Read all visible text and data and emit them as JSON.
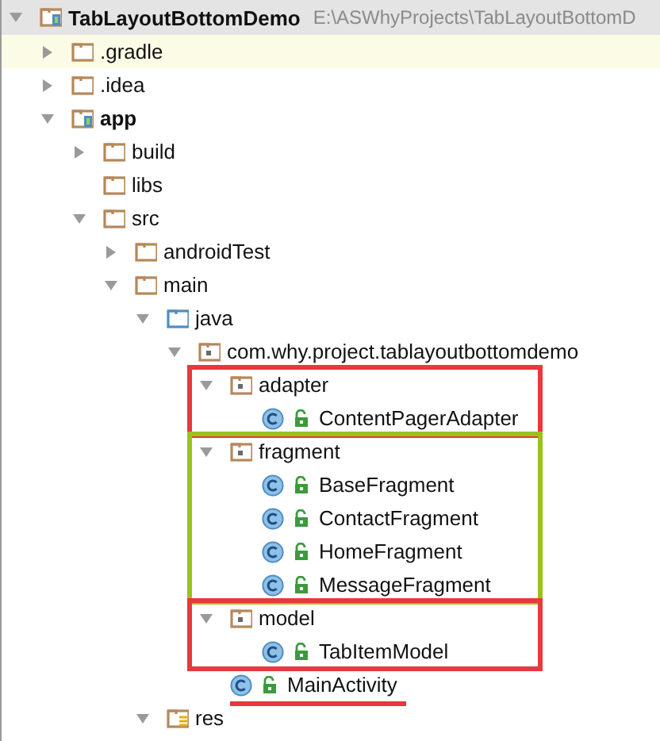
{
  "project": {
    "name": "TabLayoutBottomDemo",
    "path": "E:\\ASWhyProjects\\TabLayoutBottomD",
    "expanded": true,
    "selected": true,
    "kind": "module",
    "children": [
      {
        "label": ".gradle",
        "kind": "folder",
        "expanded": false,
        "hovered": true
      },
      {
        "label": ".idea",
        "kind": "folder",
        "expanded": false,
        "hovered": false
      },
      {
        "label": "app",
        "kind": "module",
        "expanded": true,
        "hovered": false,
        "children": [
          {
            "label": "build",
            "kind": "folder",
            "expanded": false,
            "hovered": false
          },
          {
            "label": "libs",
            "kind": "folder",
            "hovered": false
          },
          {
            "label": "src",
            "kind": "folder",
            "expanded": true,
            "hovered": false,
            "children": [
              {
                "label": "androidTest",
                "kind": "folder",
                "expanded": false,
                "hovered": false
              },
              {
                "label": "main",
                "kind": "folder",
                "expanded": true,
                "hovered": false,
                "children": [
                  {
                    "label": "java",
                    "kind": "source-folder",
                    "expanded": true,
                    "hovered": false,
                    "children": [
                      {
                        "label": "com.why.project.tablayoutbottomdemo",
                        "kind": "package",
                        "expanded": true,
                        "hovered": false,
                        "children": [
                          {
                            "label": "adapter",
                            "kind": "package",
                            "expanded": true,
                            "hovered": false,
                            "highlight": {
                              "kind": "box",
                              "color": "#e8383d"
                            },
                            "children": [
                              {
                                "label": "ContentPagerAdapter",
                                "kind": "class",
                                "hovered": false
                              }
                            ]
                          },
                          {
                            "label": "fragment",
                            "kind": "package",
                            "expanded": true,
                            "hovered": false,
                            "highlight": {
                              "kind": "box",
                              "color": "#99c21a"
                            },
                            "children": [
                              {
                                "label": "BaseFragment",
                                "kind": "class",
                                "hovered": false
                              },
                              {
                                "label": "ContactFragment",
                                "kind": "class",
                                "hovered": false
                              },
                              {
                                "label": "HomeFragment",
                                "kind": "class",
                                "hovered": false
                              },
                              {
                                "label": "MessageFragment",
                                "kind": "class",
                                "hovered": false
                              }
                            ]
                          },
                          {
                            "label": "model",
                            "kind": "package",
                            "expanded": true,
                            "hovered": false,
                            "highlight": {
                              "kind": "box",
                              "color": "#e8383d"
                            },
                            "children": [
                              {
                                "label": "TabItemModel",
                                "kind": "class",
                                "hovered": false
                              }
                            ]
                          },
                          {
                            "label": "MainActivity",
                            "kind": "class",
                            "hovered": false,
                            "highlight": {
                              "kind": "underline",
                              "color": "#e8383d"
                            }
                          }
                        ]
                      }
                    ]
                  },
                  {
                    "label": "res",
                    "kind": "res-folder",
                    "expanded": true,
                    "hovered": false
                  }
                ]
              }
            ]
          }
        ]
      }
    ]
  }
}
